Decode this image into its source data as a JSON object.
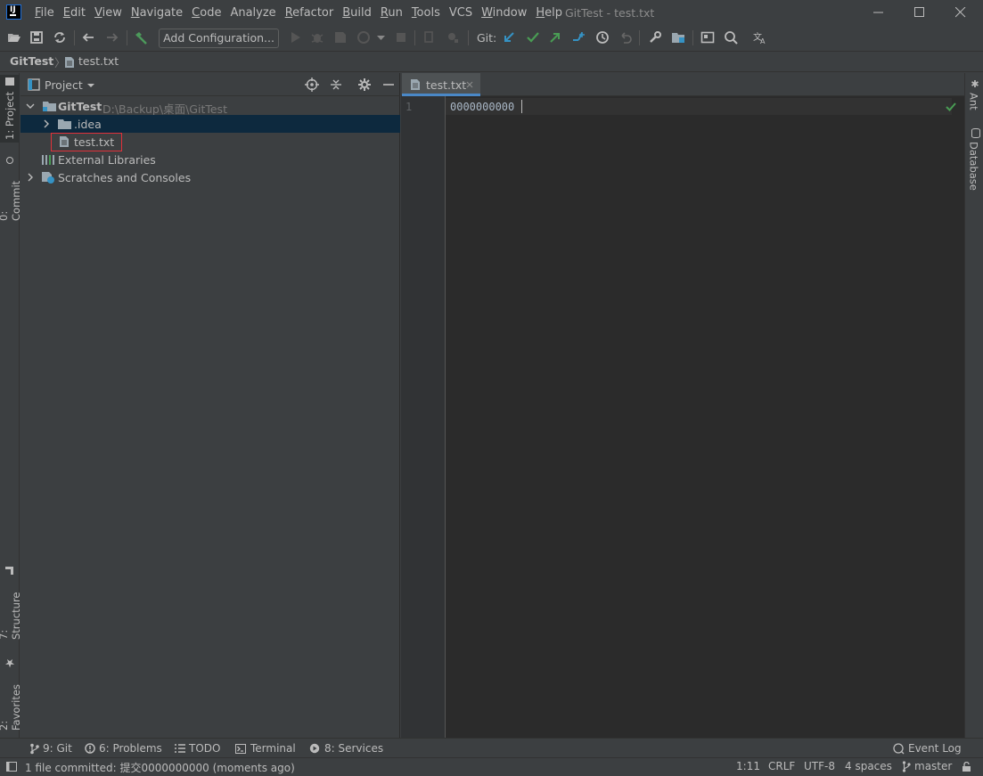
{
  "window": {
    "title": "GitTest - test.txt",
    "app_icon_letter": "IJ"
  },
  "menu": [
    {
      "label": "File",
      "mnemonic": "F",
      "rest": "ile"
    },
    {
      "label": "Edit",
      "mnemonic": "E",
      "rest": "dit"
    },
    {
      "label": "View",
      "mnemonic": "V",
      "rest": "iew"
    },
    {
      "label": "Navigate",
      "mnemonic": "N",
      "rest": "avigate"
    },
    {
      "label": "Code",
      "mnemonic": "C",
      "rest": "ode"
    },
    {
      "label": "Analyze",
      "mnemonic": "",
      "rest": "Analyze"
    },
    {
      "label": "Refactor",
      "mnemonic": "R",
      "rest": "efactor"
    },
    {
      "label": "Build",
      "mnemonic": "B",
      "rest": "uild"
    },
    {
      "label": "Run",
      "mnemonic": "R",
      "rest": "un"
    },
    {
      "label": "Tools",
      "mnemonic": "T",
      "rest": "ools"
    },
    {
      "label": "VCS",
      "mnemonic": "",
      "rest": "VCS"
    },
    {
      "label": "Window",
      "mnemonic": "W",
      "rest": "indow"
    },
    {
      "label": "Help",
      "mnemonic": "H",
      "rest": "elp"
    }
  ],
  "toolbar": {
    "add_configuration_label": "Add Configuration...",
    "git_label": "Git:"
  },
  "navbar": {
    "project": "GitTest",
    "file": "test.txt"
  },
  "left_stripe": {
    "project_tab": "1: Project",
    "commit_tab": "0: Commit",
    "structure_tab": "7: Structure",
    "favorites_tab": "2: Favorites"
  },
  "project_panel": {
    "title": "Project",
    "root_name": "GitTest",
    "root_path": "D:\\Backup\\桌面\\GitTest",
    "items": [
      {
        "label": ".idea"
      },
      {
        "label": "test.txt"
      },
      {
        "label": "External Libraries"
      },
      {
        "label": "Scratches and Consoles"
      }
    ]
  },
  "editor": {
    "tab_label": "test.txt",
    "line_number": "1",
    "line_text": "0000000000"
  },
  "right_stripe": {
    "ant_tab": "Ant",
    "database_tab": "Database"
  },
  "bottom_tools": {
    "git": "9: Git",
    "problems": "6: Problems",
    "todo": "TODO",
    "terminal": "Terminal",
    "services": "8: Services",
    "event_log": "Event Log"
  },
  "statusbar": {
    "message": "1 file committed: 提交0000000000 (moments ago)",
    "position": "1:11",
    "line_separator": "CRLF",
    "encoding": "UTF-8",
    "indent": "4 spaces",
    "branch": "master"
  },
  "colors": {
    "background": "#3c3f41",
    "editor_background": "#2b2b2b",
    "selection": "#0d293e",
    "highlight_box": "#e0313a",
    "tab_underline": "#4a88c7",
    "git_blue": "#3592c4",
    "git_green": "#499c54"
  }
}
